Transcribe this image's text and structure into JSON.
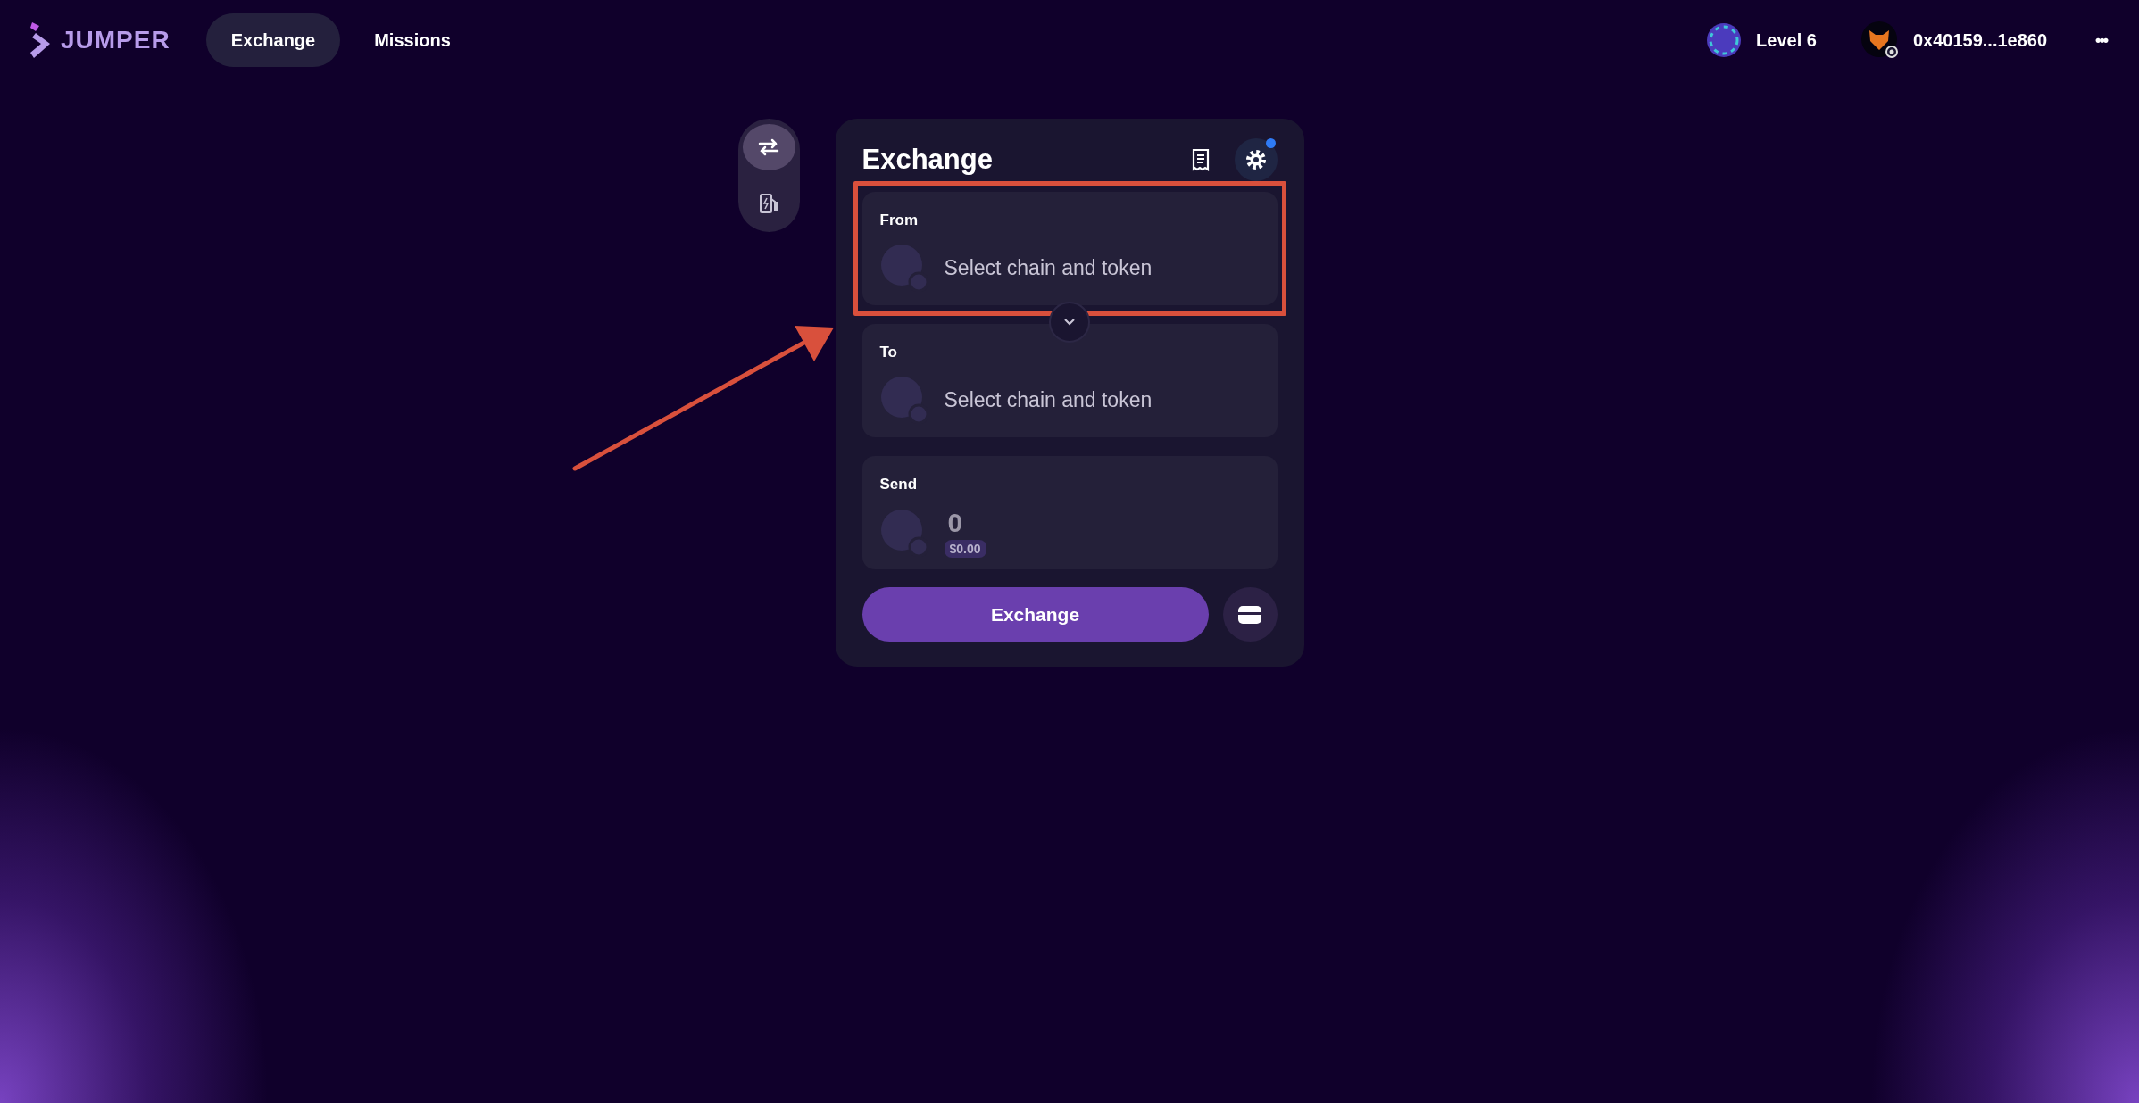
{
  "header": {
    "logo_text": "JUMPER",
    "nav": [
      {
        "label": "Exchange",
        "selected": true
      },
      {
        "label": "Missions",
        "selected": false
      }
    ],
    "level": "Level 6",
    "wallet_address": "0x40159...1e860",
    "more": "•••"
  },
  "side_rail": [
    {
      "kind": "exchange",
      "selected": true
    },
    {
      "kind": "gas",
      "selected": false
    }
  ],
  "widget": {
    "title": "Exchange",
    "settings_notification": true,
    "sections": [
      {
        "kind": "select",
        "label": "From",
        "placeholder": "Select chain and token",
        "highlighted": true
      },
      {
        "kind": "select",
        "label": "To",
        "placeholder": "Select chain and token",
        "highlighted": false
      },
      {
        "kind": "amount",
        "label": "Send",
        "value": "0",
        "usd": "$0.00",
        "highlighted": false
      }
    ],
    "button": "Exchange"
  },
  "annotations": [
    {
      "kind": "arrow"
    }
  ]
}
